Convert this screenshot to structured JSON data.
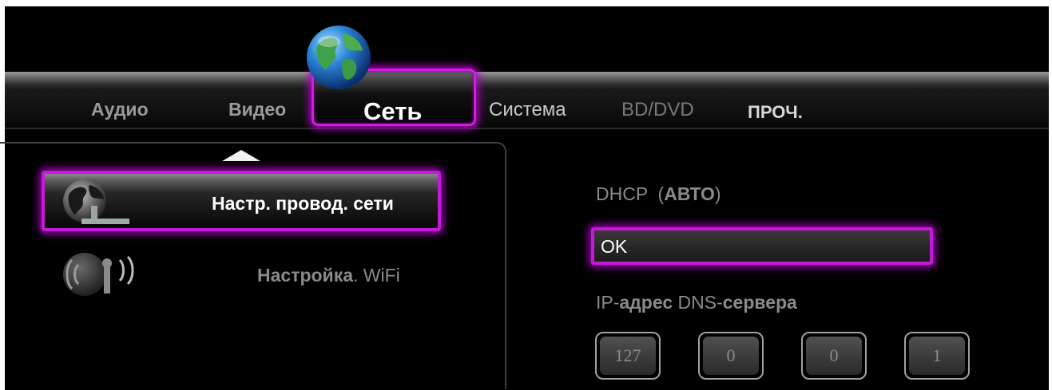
{
  "tabs": [
    {
      "label": "Аудио"
    },
    {
      "label": "Видео"
    },
    {
      "label": "Сеть",
      "active": true
    },
    {
      "label": "Система"
    },
    {
      "label": "BD/DVD"
    },
    {
      "label": "ПРОЧ."
    }
  ],
  "menu": {
    "items": [
      {
        "label": "Настр. провод. сети",
        "icon": "wired-network-globe-icon",
        "selected": true
      },
      {
        "label_bold": "Настройка",
        "label_rest": ". WiFi",
        "icon": "wifi-icon"
      }
    ]
  },
  "settings": {
    "dhcp_prefix": "DHCP  (",
    "dhcp_mode": "АВТО",
    "dhcp_suffix": ")",
    "ok_value": "OK",
    "dns_part1": "IP-",
    "dns_part2": "адрес",
    "dns_part3": " DNS-",
    "dns_part4": "сервера",
    "ip_octets": [
      "127",
      "0",
      "0",
      "1"
    ]
  },
  "colors": {
    "accent": "#c21ad6",
    "background": "#000000",
    "text_dim": "#8a8a8a"
  }
}
